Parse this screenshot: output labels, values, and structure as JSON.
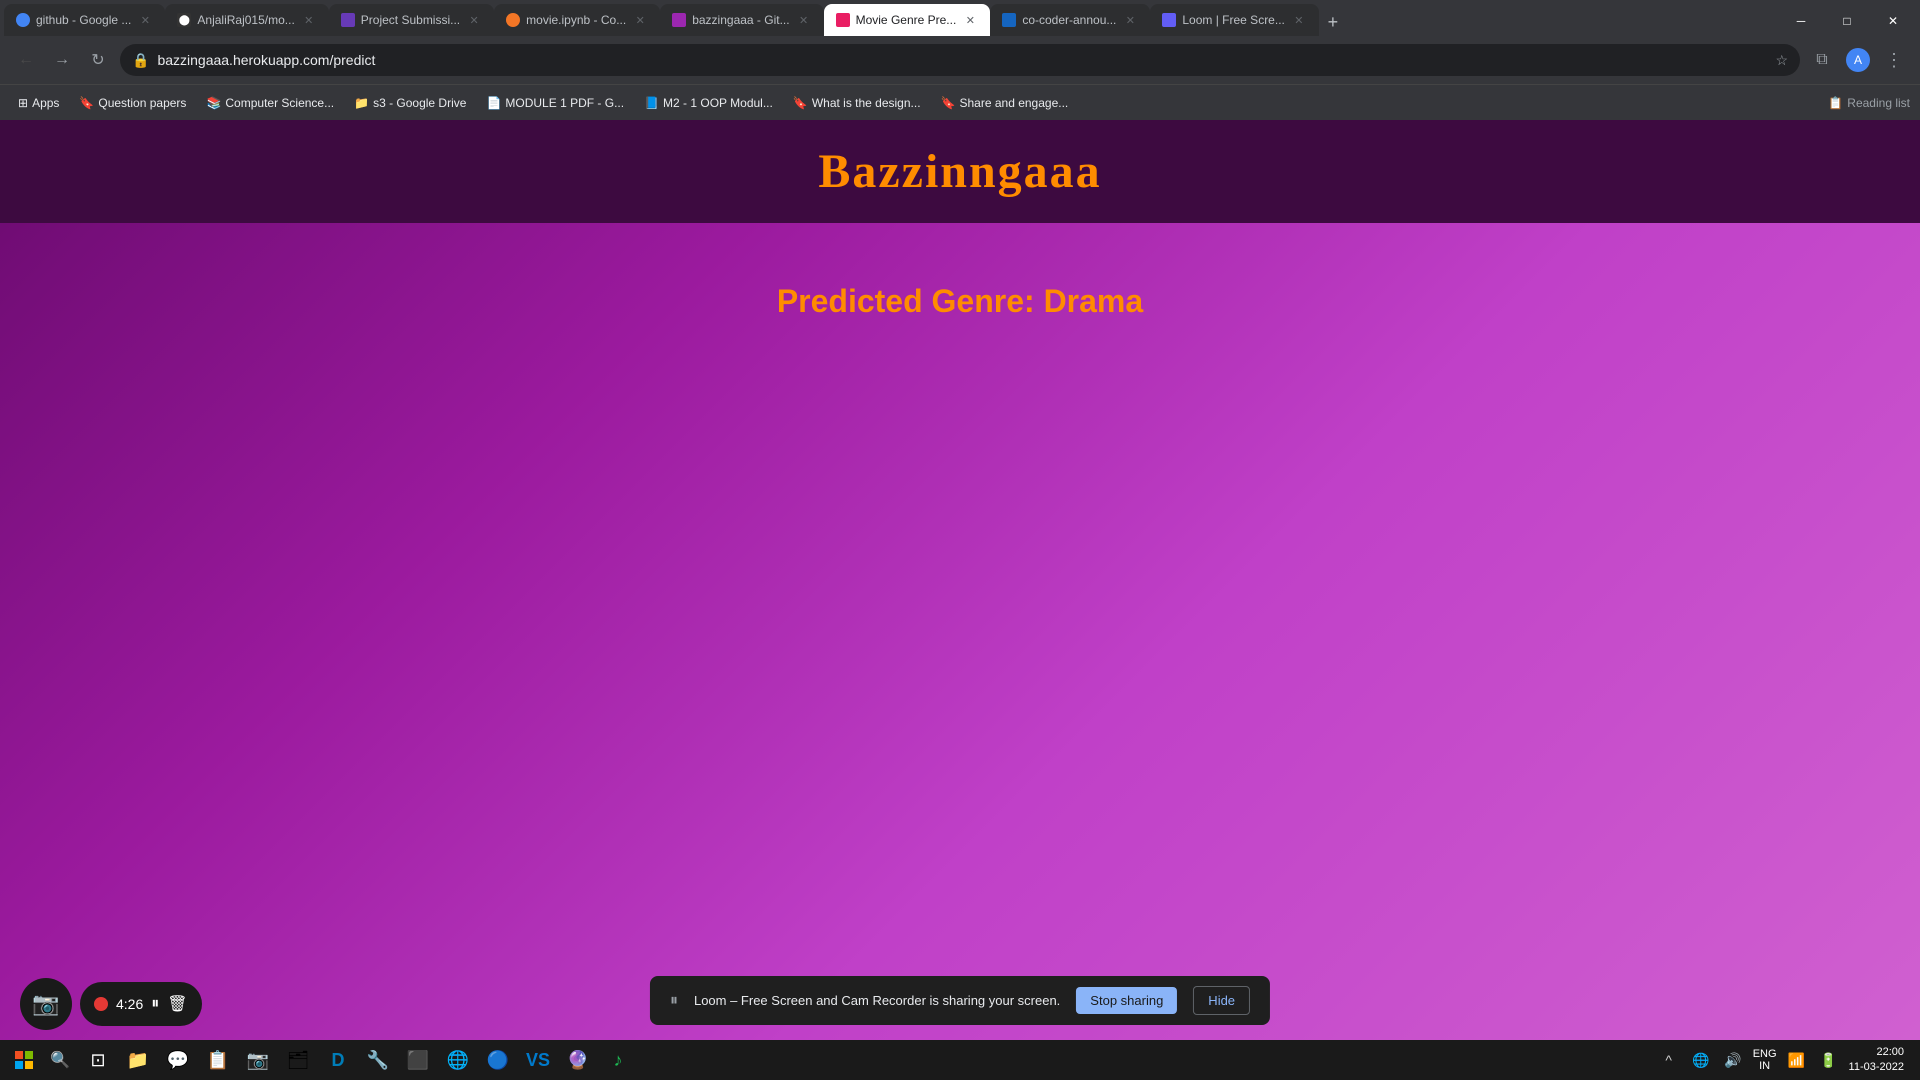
{
  "browser": {
    "url": "bazzingaaa.herokuapp.com/predict",
    "tabs": [
      {
        "id": "tab-google",
        "label": "github - Google ...",
        "favicon_type": "fav-google",
        "active": false
      },
      {
        "id": "tab-anjali",
        "label": "AnjaliRaj015/mo...",
        "favicon_type": "fav-github",
        "active": false
      },
      {
        "id": "tab-project",
        "label": "Project Submissi...",
        "favicon_type": "fav-project",
        "active": false
      },
      {
        "id": "tab-movie-ipynb",
        "label": "movie.ipynb - Co...",
        "favicon_type": "fav-jupyter",
        "active": false
      },
      {
        "id": "tab-bazzingaaa-git",
        "label": "bazzingaaa - Git...",
        "favicon_type": "fav-bazzingaaa",
        "active": false
      },
      {
        "id": "tab-movie-genre",
        "label": "Movie Genre Pre...",
        "favicon_type": "fav-movie",
        "active": true
      },
      {
        "id": "tab-co-coder",
        "label": "co-coder-annou...",
        "favicon_type": "fav-coder",
        "active": false
      },
      {
        "id": "tab-loom",
        "label": "Loom | Free Scre...",
        "favicon_type": "fav-loom",
        "active": false
      }
    ],
    "bookmarks": [
      {
        "label": "Apps",
        "icon": "⊞"
      },
      {
        "label": "Question papers",
        "icon": "🔖"
      },
      {
        "label": "Computer Science...",
        "icon": "📚"
      },
      {
        "label": "s3 - Google Drive",
        "icon": "📁"
      },
      {
        "label": "MODULE 1 PDF - G...",
        "icon": "📄"
      },
      {
        "label": "M2 - 1 OOP Modul...",
        "icon": "📘"
      },
      {
        "label": "What is the design...",
        "icon": "🔖"
      },
      {
        "label": "Share and engage...",
        "icon": "🔖"
      }
    ]
  },
  "page": {
    "title": "Bazzinngaaa",
    "predicted_label": "Predicted Genre:",
    "predicted_genre": "Drama",
    "header_bg": "#3d0a40",
    "title_color": "#ff8c00",
    "genre_color": "#ff8c00",
    "bg_gradient_start": "#6a0a6e",
    "bg_gradient_end": "#d060d0"
  },
  "loom": {
    "timer": "4:26",
    "pause_icon": "⏸",
    "delete_icon": "🗑"
  },
  "sharing_bar": {
    "pause_icon": "⏸",
    "message": "Loom – Free Screen and Cam Recorder is sharing your screen.",
    "stop_label": "Stop sharing",
    "hide_label": "Hide"
  },
  "taskbar": {
    "clock": "22:00",
    "date": "11-03-2022",
    "language": "ENG\nIN"
  }
}
